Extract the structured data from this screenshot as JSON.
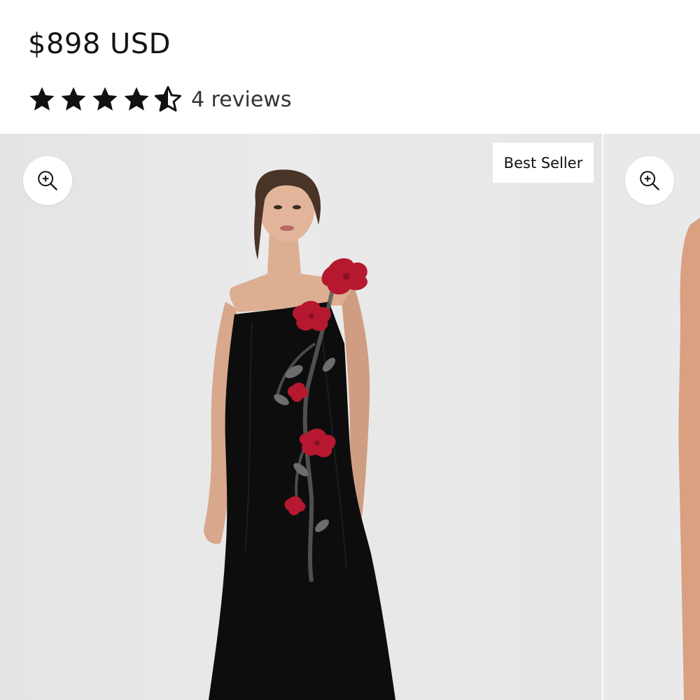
{
  "product": {
    "price": "$898 USD",
    "rating": 4.5,
    "rating_max": 5,
    "reviews_label": "4 reviews"
  },
  "gallery": {
    "badge": "Best Seller",
    "zoom_icon": "zoom-in-icon",
    "slides": [
      {
        "image": "model in black one-shoulder gown with red floral embroidery"
      },
      {
        "image": "next product photo (partially visible)"
      }
    ]
  },
  "colors": {
    "background": "#ffffff",
    "photo_backdrop": "#e6e6e6",
    "dress": "#0d0d0d",
    "floral_red": "#b5182f",
    "star": "#111111"
  }
}
